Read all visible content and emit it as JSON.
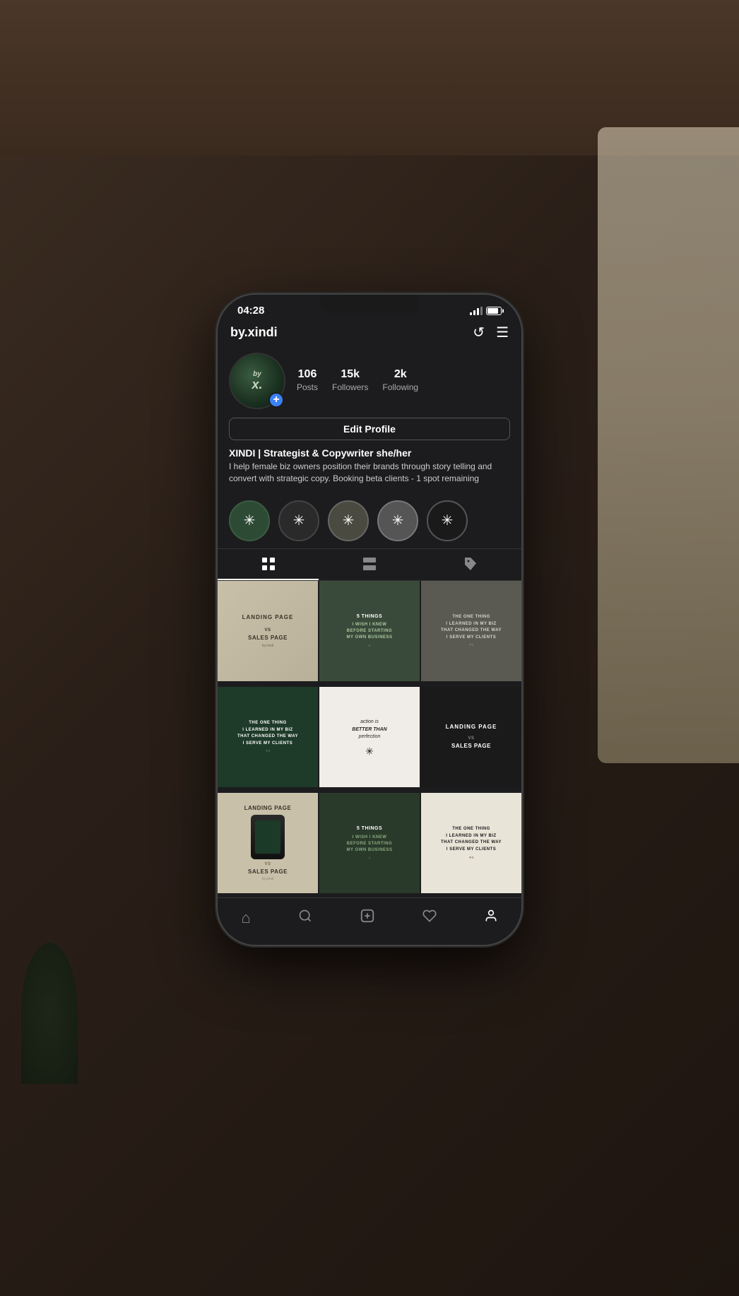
{
  "background": {
    "color": "#2a1f1a"
  },
  "status_bar": {
    "time": "04:28",
    "battery_pct": 75
  },
  "header": {
    "username": "by.xindi",
    "refresh_icon": "↺",
    "menu_icon": "☰"
  },
  "profile": {
    "avatar_text": "by\nx.",
    "stats": [
      {
        "value": "106",
        "label": "Posts"
      },
      {
        "value": "15k",
        "label": "Followers"
      },
      {
        "value": "2k",
        "label": "Following"
      }
    ],
    "edit_button_label": "Edit Profile",
    "bio_name": "XINDI | Strategist & Copywriter  she/her",
    "bio_text": "I help female biz owners position their brands through story telling and convert with strategic copy.\nBooking beta clients - 1 spot remaining"
  },
  "highlights": [
    {
      "id": "h1",
      "style": "green",
      "icon": "✳"
    },
    {
      "id": "h2",
      "style": "gray1",
      "icon": "✳"
    },
    {
      "id": "h3",
      "style": "gray2",
      "icon": "✳"
    },
    {
      "id": "h4",
      "style": "gray3",
      "icon": "✳"
    },
    {
      "id": "h5",
      "style": "dark",
      "icon": "✳"
    }
  ],
  "tabs": [
    {
      "id": "grid",
      "icon": "⊞",
      "active": true
    },
    {
      "id": "list",
      "icon": "▤",
      "active": false
    },
    {
      "id": "tagged",
      "icon": "🏷",
      "active": false
    }
  ],
  "posts": [
    {
      "id": "p1",
      "type": "landing",
      "bg": "#c8c0a8",
      "lines": [
        "LANDING PAGE",
        "vs",
        "SALES PAGE"
      ],
      "has_phone": true
    },
    {
      "id": "p2",
      "type": "5things",
      "bg": "#3a4a3a",
      "lines": [
        "5 THINGS",
        "I WISH I KNEW",
        "BEFORE STARTING",
        "MY OWN BUSINESS"
      ]
    },
    {
      "id": "p3",
      "type": "one-thing",
      "bg": "#5a5a52",
      "lines": [
        "THE ONE THING",
        "I LEARNED IN MY BIZ",
        "THAT CHANGED THE WAY",
        "I SERVE MY CLIENTS"
      ]
    },
    {
      "id": "p4",
      "type": "one-thing-green",
      "bg": "#1e3a28",
      "lines": [
        "THE ONE THING",
        "I LEARNED IN MY BIZ",
        "THAT CHANGED THE WAY",
        "I SERVE MY CLIENTS"
      ]
    },
    {
      "id": "p5",
      "type": "action",
      "bg": "#f0ede8",
      "lines": [
        "action is BETTER THAN perfection"
      ]
    },
    {
      "id": "p6",
      "type": "landing-dark",
      "bg": "#1a1a1a",
      "lines": [
        "LANDING PAGE",
        "vs",
        "SALES PAGE"
      ],
      "has_phone": true
    },
    {
      "id": "p7",
      "type": "landing2",
      "bg": "#c8c0a8",
      "lines": [
        "LANDING PAGE",
        "vs",
        "SALES PAGE"
      ],
      "has_phone": true
    },
    {
      "id": "p8",
      "type": "5things2",
      "bg": "#2a3a2a",
      "lines": [
        "5 THINGS",
        "I WISH I KNEW",
        "BEFORE STARTING",
        "MY OWN BUSINESS"
      ]
    },
    {
      "id": "p9",
      "type": "one-thing-cream",
      "bg": "#e8e4d8",
      "lines": [
        "THE ONE THING",
        "I LEARNED IN MY BIZ",
        "THAT CHANGED THE WAY",
        "I SERVE MY CLIENTS"
      ]
    }
  ],
  "bottom_nav": [
    {
      "id": "home",
      "icon": "⌂",
      "active": false
    },
    {
      "id": "search",
      "icon": "🔍",
      "active": false
    },
    {
      "id": "add",
      "icon": "⊕",
      "active": false
    },
    {
      "id": "heart",
      "icon": "♡",
      "active": false
    },
    {
      "id": "profile",
      "icon": "👤",
      "active": true
    }
  ]
}
